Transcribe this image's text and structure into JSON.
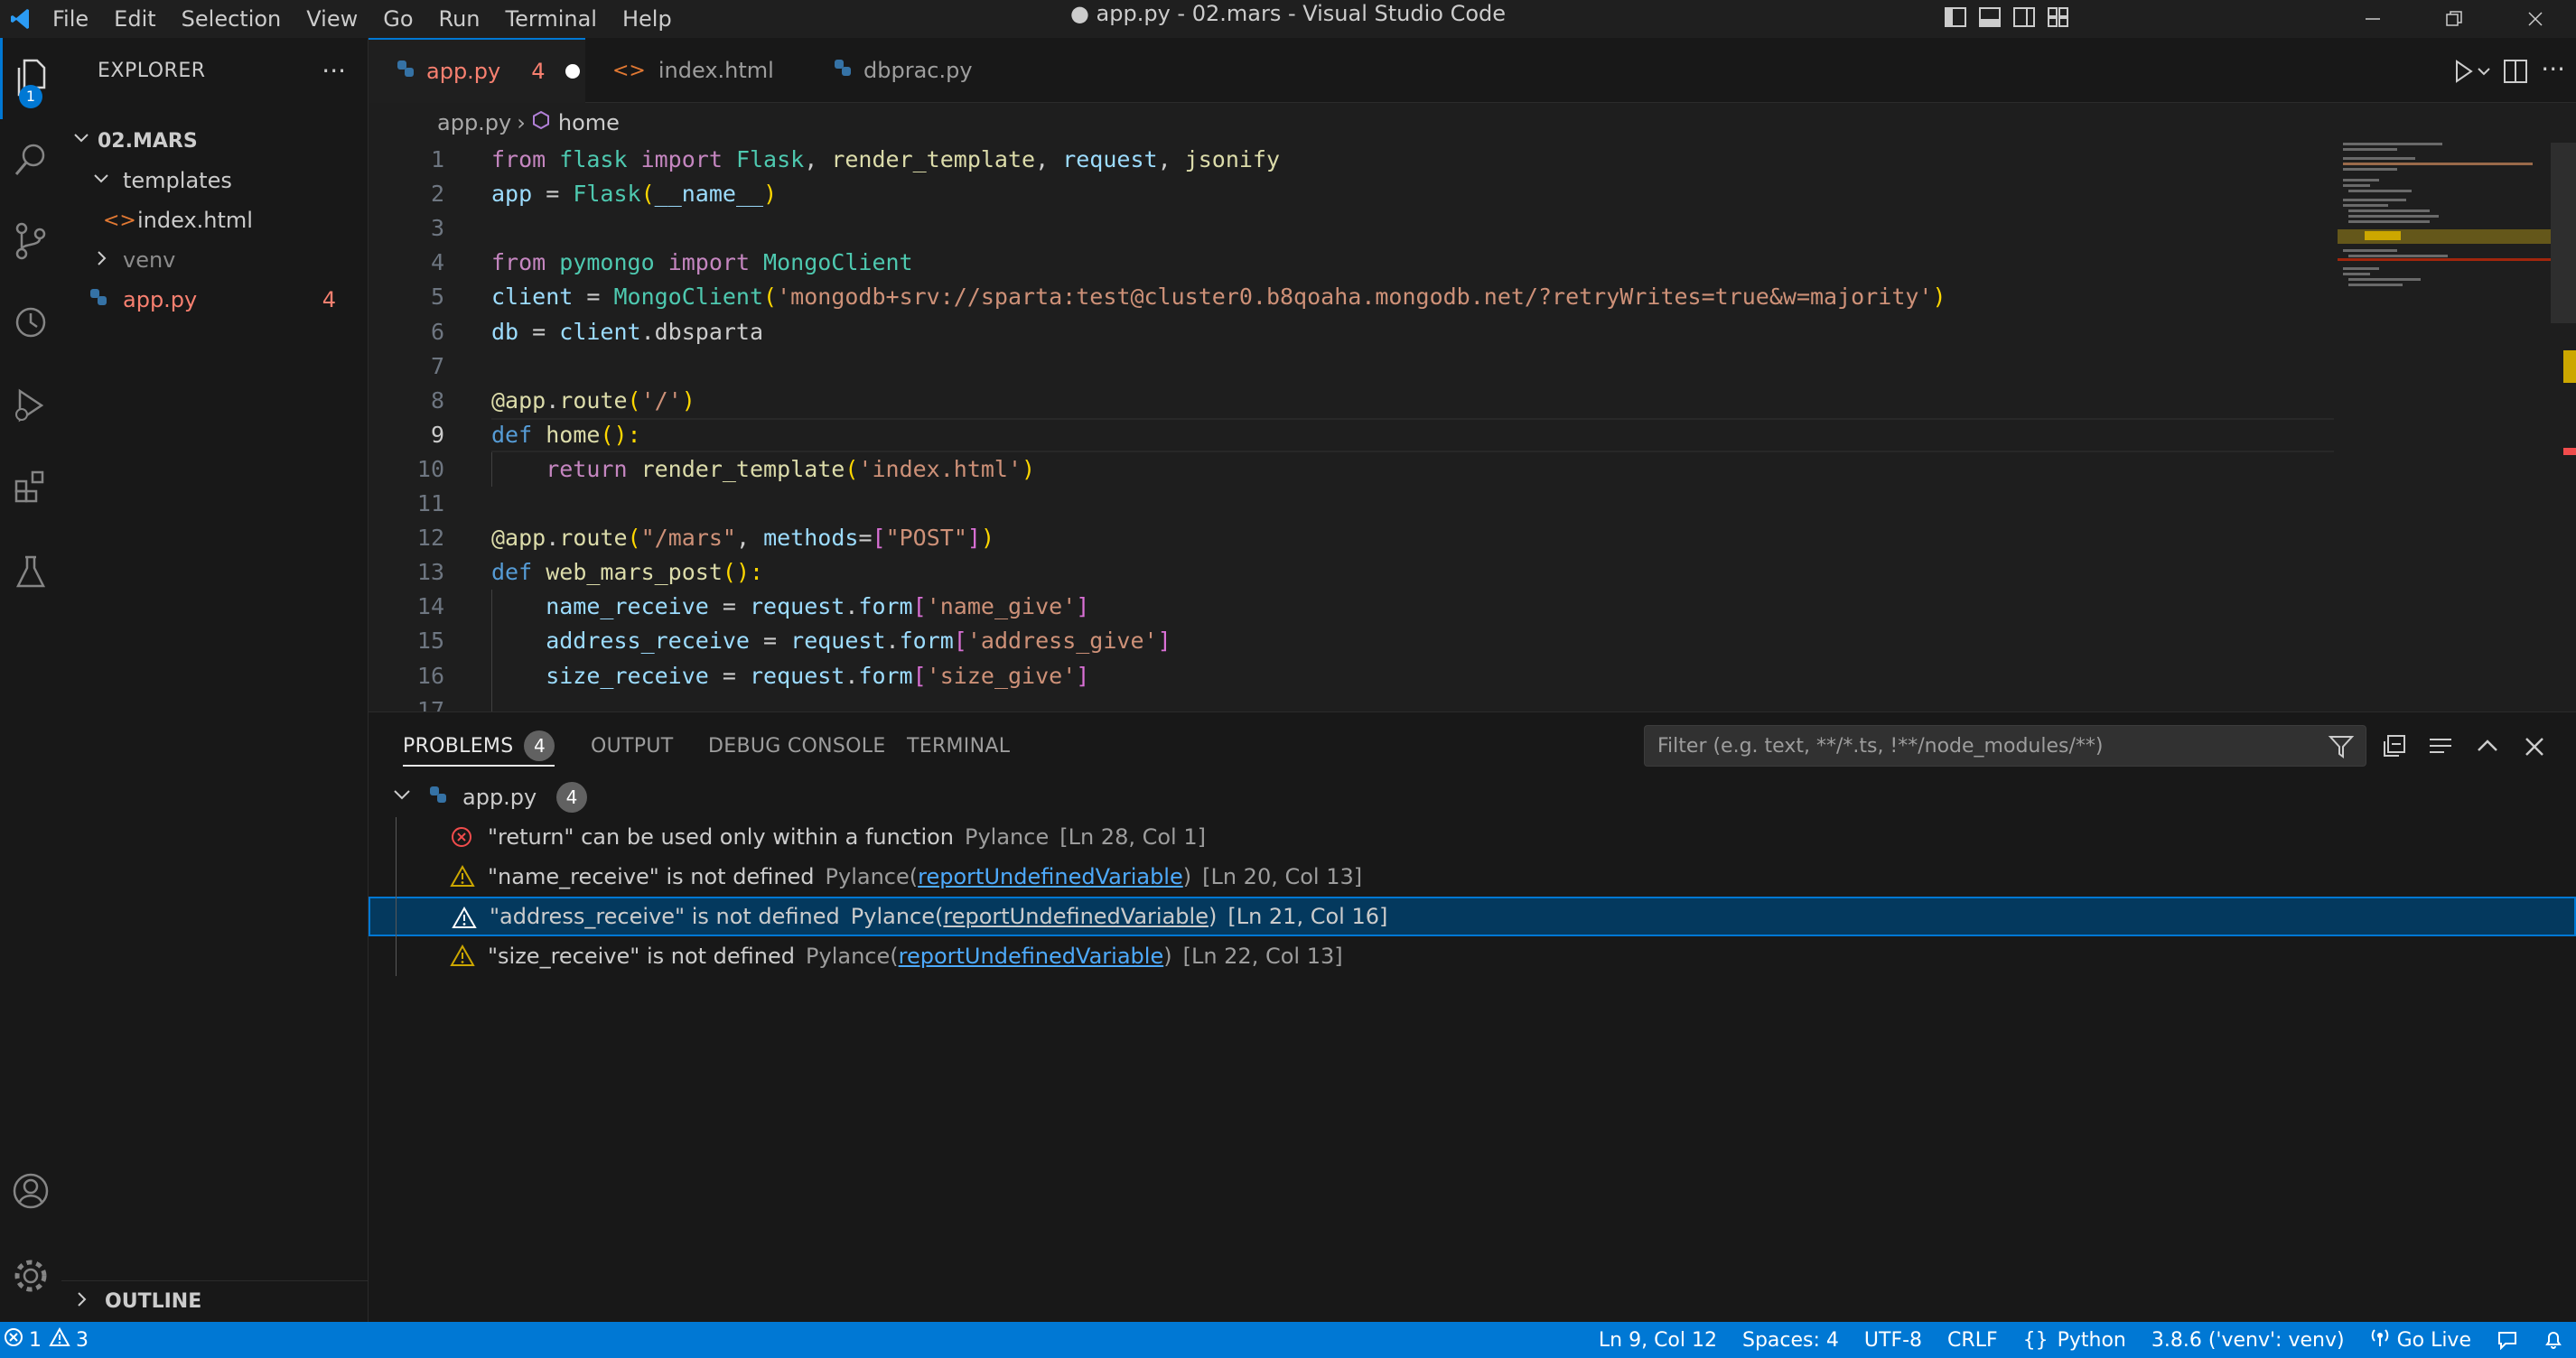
{
  "window": {
    "title": "● app.py - 02.mars - Visual Studio Code",
    "menu": [
      "File",
      "Edit",
      "Selection",
      "View",
      "Go",
      "Run",
      "Terminal",
      "Help"
    ]
  },
  "activity_bar": {
    "explorer_badge": "1",
    "icons": [
      "files-icon",
      "search-icon",
      "source-control-icon",
      "timeline-icon",
      "run-debug-icon",
      "extensions-icon",
      "testing-icon",
      "account-icon",
      "settings-gear-icon"
    ]
  },
  "sidebar": {
    "title": "EXPLORER",
    "root": "02.MARS",
    "items": [
      {
        "label": "templates",
        "type": "folder-open"
      },
      {
        "label": "index.html",
        "type": "html"
      },
      {
        "label": "venv",
        "type": "folder"
      },
      {
        "label": "app.py",
        "type": "python",
        "badge": "4"
      }
    ],
    "outline_label": "OUTLINE"
  },
  "tabs": [
    {
      "label": "app.py",
      "count": "4",
      "modified": true,
      "active": true
    },
    {
      "label": "index.html",
      "active": false
    },
    {
      "label": "dbprac.py",
      "active": false
    }
  ],
  "breadcrumb": {
    "file": "app.py",
    "symbol": "home"
  },
  "editor": {
    "current_line": 9,
    "lines": [
      {
        "n": "1",
        "tokens": [
          {
            "t": "from ",
            "c": "k"
          },
          {
            "t": "flask ",
            "c": "c"
          },
          {
            "t": "import ",
            "c": "k"
          },
          {
            "t": "Flask",
            "c": "c"
          },
          {
            "t": ", ",
            "c": "t"
          },
          {
            "t": "render_template",
            "c": "f"
          },
          {
            "t": ", ",
            "c": "t"
          },
          {
            "t": "request",
            "c": "v"
          },
          {
            "t": ", ",
            "c": "t"
          },
          {
            "t": "jsonify",
            "c": "f"
          }
        ]
      },
      {
        "n": "2",
        "tokens": [
          {
            "t": "app ",
            "c": "v"
          },
          {
            "t": "= ",
            "c": "t"
          },
          {
            "t": "Flask",
            "c": "c"
          },
          {
            "t": "(",
            "c": "y"
          },
          {
            "t": "__name__",
            "c": "v"
          },
          {
            "t": ")",
            "c": "y"
          }
        ]
      },
      {
        "n": "3",
        "tokens": []
      },
      {
        "n": "4",
        "tokens": [
          {
            "t": "from ",
            "c": "k"
          },
          {
            "t": "pymongo ",
            "c": "c"
          },
          {
            "t": "import ",
            "c": "k"
          },
          {
            "t": "MongoClient",
            "c": "c"
          }
        ]
      },
      {
        "n": "5",
        "tokens": [
          {
            "t": "client ",
            "c": "v"
          },
          {
            "t": "= ",
            "c": "t"
          },
          {
            "t": "MongoClient",
            "c": "c"
          },
          {
            "t": "(",
            "c": "y"
          },
          {
            "t": "'mongodb+srv://sparta:test@cluster0.b8qoaha.mongodb.net/?retryWrites=true&w=majority'",
            "c": "s"
          },
          {
            "t": ")",
            "c": "y"
          }
        ]
      },
      {
        "n": "6",
        "tokens": [
          {
            "t": "db ",
            "c": "v"
          },
          {
            "t": "= ",
            "c": "t"
          },
          {
            "t": "client",
            "c": "v"
          },
          {
            "t": ".dbsparta",
            "c": "t"
          }
        ]
      },
      {
        "n": "7",
        "tokens": []
      },
      {
        "n": "8",
        "tokens": [
          {
            "t": "@app",
            "c": "f"
          },
          {
            "t": ".",
            "c": "t"
          },
          {
            "t": "route",
            "c": "f"
          },
          {
            "t": "(",
            "c": "y"
          },
          {
            "t": "'/'",
            "c": "s"
          },
          {
            "t": ")",
            "c": "y"
          }
        ]
      },
      {
        "n": "9",
        "tokens": [
          {
            "t": "def ",
            "c": "kw"
          },
          {
            "t": "home",
            "c": "f"
          },
          {
            "t": "():",
            "c": "y"
          }
        ]
      },
      {
        "n": "10",
        "tokens": [
          {
            "t": "    return ",
            "c": "k"
          },
          {
            "t": "render_template",
            "c": "f"
          },
          {
            "t": "(",
            "c": "y"
          },
          {
            "t": "'index.html'",
            "c": "s"
          },
          {
            "t": ")",
            "c": "y"
          }
        ]
      },
      {
        "n": "11",
        "tokens": []
      },
      {
        "n": "12",
        "tokens": [
          {
            "t": "@app",
            "c": "f"
          },
          {
            "t": ".",
            "c": "t"
          },
          {
            "t": "route",
            "c": "f"
          },
          {
            "t": "(",
            "c": "y"
          },
          {
            "t": "\"/mars\"",
            "c": "s"
          },
          {
            "t": ", ",
            "c": "t"
          },
          {
            "t": "methods",
            "c": "v"
          },
          {
            "t": "=",
            "c": "t"
          },
          {
            "t": "[",
            "c": "p"
          },
          {
            "t": "\"POST\"",
            "c": "s"
          },
          {
            "t": "]",
            "c": "p"
          },
          {
            "t": ")",
            "c": "y"
          }
        ]
      },
      {
        "n": "13",
        "tokens": [
          {
            "t": "def ",
            "c": "kw"
          },
          {
            "t": "web_mars_post",
            "c": "f"
          },
          {
            "t": "():",
            "c": "y"
          }
        ]
      },
      {
        "n": "14",
        "tokens": [
          {
            "t": "    name_receive ",
            "c": "v"
          },
          {
            "t": "= ",
            "c": "t"
          },
          {
            "t": "request",
            "c": "v"
          },
          {
            "t": ".",
            "c": "t"
          },
          {
            "t": "form",
            "c": "v"
          },
          {
            "t": "[",
            "c": "p"
          },
          {
            "t": "'name_give'",
            "c": "s"
          },
          {
            "t": "]",
            "c": "p"
          }
        ]
      },
      {
        "n": "15",
        "tokens": [
          {
            "t": "    address_receive ",
            "c": "v"
          },
          {
            "t": "= ",
            "c": "t"
          },
          {
            "t": "request",
            "c": "v"
          },
          {
            "t": ".",
            "c": "t"
          },
          {
            "t": "form",
            "c": "v"
          },
          {
            "t": "[",
            "c": "p"
          },
          {
            "t": "'address_give'",
            "c": "s"
          },
          {
            "t": "]",
            "c": "p"
          }
        ]
      },
      {
        "n": "16",
        "tokens": [
          {
            "t": "    size_receive ",
            "c": "v"
          },
          {
            "t": "= ",
            "c": "t"
          },
          {
            "t": "request",
            "c": "v"
          },
          {
            "t": ".",
            "c": "t"
          },
          {
            "t": "form",
            "c": "v"
          },
          {
            "t": "[",
            "c": "p"
          },
          {
            "t": "'size_give'",
            "c": "s"
          },
          {
            "t": "]",
            "c": "p"
          }
        ]
      },
      {
        "n": "17",
        "tokens": []
      }
    ]
  },
  "panel": {
    "tabs": [
      {
        "label": "PROBLEMS",
        "badge": "4",
        "active": true
      },
      {
        "label": "OUTPUT"
      },
      {
        "label": "DEBUG CONSOLE"
      },
      {
        "label": "TERMINAL"
      }
    ],
    "filter_placeholder": "Filter (e.g. text, **/*.ts, !**/node_modules/**)",
    "file": {
      "name": "app.py",
      "count": "4"
    },
    "problems": [
      {
        "severity": "error",
        "message": "\"return\" can be used only within a function",
        "source": "Pylance",
        "rule": "",
        "location": "[Ln 28, Col 1]"
      },
      {
        "severity": "warning",
        "message": "\"name_receive\" is not defined",
        "source": "Pylance",
        "rule": "reportUndefinedVariable",
        "location": "[Ln 20, Col 13]"
      },
      {
        "severity": "warning",
        "message": "\"address_receive\" is not defined",
        "source": "Pylance",
        "rule": "reportUndefinedVariable",
        "location": "[Ln 21, Col 16]",
        "selected": true
      },
      {
        "severity": "warning",
        "message": "\"size_receive\" is not defined",
        "source": "Pylance",
        "rule": "reportUndefinedVariable",
        "location": "[Ln 22, Col 13]"
      }
    ]
  },
  "status": {
    "errors": "1",
    "warnings": "3",
    "position": "Ln 9, Col 12",
    "spaces": "Spaces: 4",
    "encoding": "UTF-8",
    "eol": "CRLF",
    "language": "Python",
    "interpreter": "3.8.6 ('venv': venv)",
    "go_live": "Go Live"
  },
  "colors": {
    "accent": "#0078d4",
    "error": "#f14c4c",
    "warning": "#cca700",
    "modified_tab": "#f88070"
  }
}
